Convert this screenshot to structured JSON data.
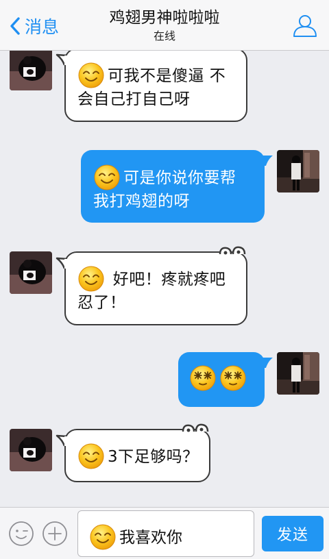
{
  "header": {
    "back_label": "消息",
    "title": "鸡翅男神啦啦啦",
    "status": "在线"
  },
  "messages": [
    {
      "direction": "in",
      "lines": [
        "可我不是傻逼 不",
        "会自己打自己呀"
      ]
    },
    {
      "direction": "out",
      "lines": [
        "可是你说你要帮",
        "我打鸡翅的呀"
      ]
    },
    {
      "direction": "in",
      "lines": [
        " 好吧！疼就疼吧",
        "忍了！"
      ]
    },
    {
      "direction": "out",
      "lines": []
    },
    {
      "direction": "in",
      "lines": [
        "3下足够吗？"
      ]
    }
  ],
  "input": {
    "value": "我喜欢你"
  },
  "toolbar": {
    "send_label": "发送"
  },
  "colors": {
    "accent": "#2196f3",
    "link": "#1f8ff2",
    "chat_background": "#ecedf1",
    "incoming_bubble": "#ffffff",
    "outgoing_bubble": "#2196f3"
  },
  "icons": {
    "back": "chevron-left-icon",
    "profile": "person-icon",
    "emoji_picker": "wink-face-icon",
    "more": "plus-circle-icon",
    "smile": "smile-emoji-icon",
    "dizzy": "dizzy-emoji-icon"
  }
}
